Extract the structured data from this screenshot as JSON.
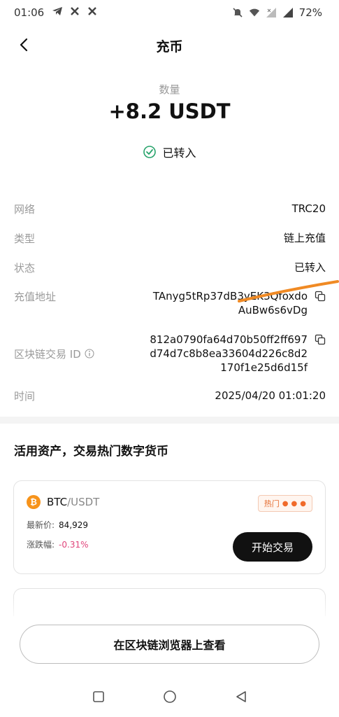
{
  "status_bar": {
    "time": "01:06",
    "battery": "72%"
  },
  "header": {
    "title": "充币"
  },
  "amount": {
    "label": "数量",
    "value": "+8.2 USDT"
  },
  "status_pill": {
    "text": "已转入"
  },
  "details": {
    "network": {
      "label": "网络",
      "value": "TRC20"
    },
    "type": {
      "label": "类型",
      "value": "链上充值"
    },
    "state": {
      "label": "状态",
      "value": "已转入"
    },
    "address": {
      "label": "充值地址",
      "line1": "TAnyg5tRp37dB3yEK3Qfoxdo",
      "line2": "AuBw6s6vDg"
    },
    "txid": {
      "label": "区块链交易 ID",
      "line1": "812a0790fa64d70b50ff2ff697",
      "line2": "d74d7c8b8ea33604d226c8d2",
      "line3": "170f1e25d6d15f"
    },
    "time": {
      "label": "时间",
      "value": "2025/04/20 01:01:20"
    }
  },
  "promo": {
    "heading": "活用资产，交易热门数字货币",
    "card": {
      "base": "BTC",
      "quote": "/USDT",
      "hot_label": "热门",
      "last_price_label": "最新价:",
      "last_price": "84,929",
      "change_label": "涨跌幅:",
      "change": "-0.31%",
      "trade_button": "开始交易"
    }
  },
  "footer": {
    "explorer_button": "在区块链浏览器上查看"
  },
  "colors": {
    "success": "#27a36b",
    "negative": "#e0457b",
    "accent_hot": "#e56b2e",
    "annotation_stroke": "#f08a24"
  },
  "icons": {
    "back": "chevron-left-icon",
    "success": "check-circle-icon",
    "copy": "copy-icon",
    "info": "info-icon",
    "coin": "bitcoin-icon",
    "flame": "flame-icon"
  }
}
